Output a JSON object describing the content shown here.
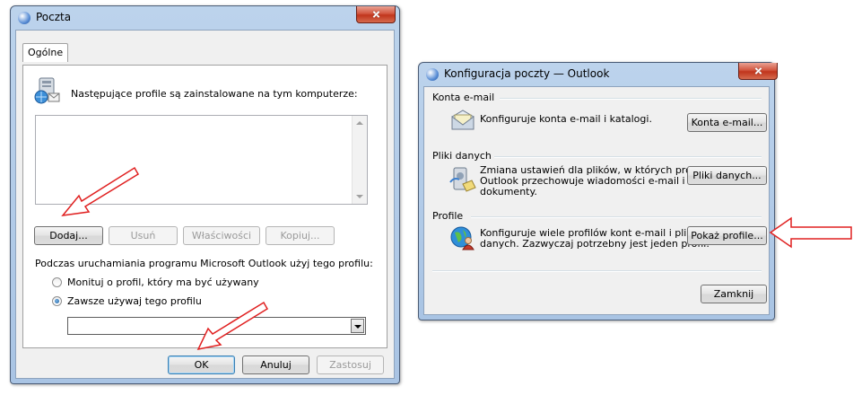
{
  "poczta": {
    "title": "Poczta",
    "tab": "Ogólne",
    "profiles_label": "Następujące profile są zainstalowane na tym komputerze:",
    "buttons": {
      "add": "Dodaj...",
      "remove": "Usuń",
      "properties": "Właściwości",
      "copy": "Kopiuj..."
    },
    "startup_label": "Podczas uruchamiania programu Microsoft Outlook użyj tego profilu:",
    "radio_prompt": "Monituj o profil, który ma być używany",
    "radio_always": "Zawsze używaj tego profilu",
    "combo_value": "",
    "footer": {
      "ok": "OK",
      "cancel": "Anuluj",
      "apply": "Zastosuj"
    }
  },
  "config": {
    "title": "Konfiguracja poczty — Outlook",
    "email": {
      "group": "Konta e-mail",
      "desc": "Konfiguruje konta e-mail i katalogi.",
      "button": "Konta e-mail..."
    },
    "data": {
      "group": "Pliki danych",
      "desc_lines": [
        "Zmiana ustawień dla plików, w których program",
        "Outlook przechowuje wiadomości e-mail i",
        "dokumenty."
      ],
      "button": "Pliki danych..."
    },
    "profiles": {
      "group": "Profile",
      "desc_lines": [
        "Konfiguruje wiele profilów kont e-mail i plików",
        "danych. Zazwyczaj potrzebny jest jeden profil."
      ],
      "button": "Pokaż profile..."
    },
    "close": "Zamknij"
  },
  "icons": {
    "poczta_app": "mail-app-icon",
    "profiles_graphic": "profiles-computer-icon",
    "email_accounts": "envelope-icon",
    "data_files": "data-files-icon",
    "profiles": "globe-user-icon",
    "annotation": "red-arrow-icon"
  },
  "colors": {
    "annotation_arrow": "#e02020",
    "title_bar": "#b9d1ea",
    "close_button": "#c7412a"
  }
}
